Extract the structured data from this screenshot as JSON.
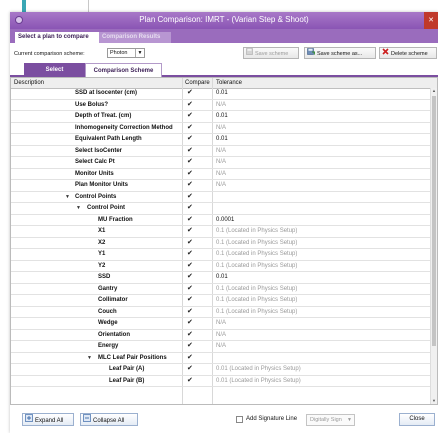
{
  "window": {
    "title": "Plan Comparison: IMRT - (Varian Step & Shoot)",
    "close_glyph": "✕"
  },
  "tabs": [
    {
      "label": "Select a plan to compare",
      "active": true
    },
    {
      "label": "Comparison Results",
      "active": false
    }
  ],
  "scheme": {
    "label": "Current comparison scheme:",
    "value": "Photon",
    "buttons": {
      "save": "Save scheme",
      "save_as": "Save scheme as...",
      "delete": "Delete scheme"
    }
  },
  "subtabs": [
    {
      "label": "Select",
      "active": false
    },
    {
      "label": "Comparison Scheme",
      "active": true
    }
  ],
  "grid": {
    "columns": {
      "description": "Description",
      "compare": "Compare",
      "tolerance": "Tolerance"
    },
    "rows": [
      {
        "level": 0,
        "label": "SSD at Isocenter (cm)",
        "checked": true,
        "tolerance": "0.01",
        "dim": false
      },
      {
        "level": 0,
        "label": "Use Bolus?",
        "checked": true,
        "tolerance": "N/A",
        "dim": true
      },
      {
        "level": 0,
        "label": "Depth of Treat. (cm)",
        "checked": true,
        "tolerance": "0.01",
        "dim": false
      },
      {
        "level": 0,
        "label": "Inhomogeneity Correction Method",
        "checked": true,
        "tolerance": "N/A",
        "dim": true
      },
      {
        "level": 0,
        "label": "Equivalent Path Length",
        "checked": true,
        "tolerance": "0.01",
        "dim": false
      },
      {
        "level": 0,
        "label": "Select IsoCenter",
        "checked": true,
        "tolerance": "N/A",
        "dim": true
      },
      {
        "level": 0,
        "label": "Select Calc Pt",
        "checked": true,
        "tolerance": "N/A",
        "dim": true
      },
      {
        "level": 0,
        "label": "Monitor Units",
        "checked": true,
        "tolerance": "N/A",
        "dim": true
      },
      {
        "level": 0,
        "label": "Plan Monitor Units",
        "checked": true,
        "tolerance": "N/A",
        "dim": true
      },
      {
        "level": -1,
        "label": "Control Points",
        "checked": true,
        "tolerance": "",
        "dim": false,
        "group": true
      },
      {
        "level": -2,
        "label": "Control Point",
        "checked": true,
        "tolerance": "",
        "dim": false,
        "group": true
      },
      {
        "level": 1,
        "label": "MU Fraction",
        "checked": true,
        "tolerance": "0.0001",
        "dim": false
      },
      {
        "level": 1,
        "label": "X1",
        "checked": true,
        "tolerance": "0.1 (Located in Physics Setup)",
        "dim": true
      },
      {
        "level": 1,
        "label": "X2",
        "checked": true,
        "tolerance": "0.1 (Located in Physics Setup)",
        "dim": true
      },
      {
        "level": 1,
        "label": "Y1",
        "checked": true,
        "tolerance": "0.1 (Located in Physics Setup)",
        "dim": true
      },
      {
        "level": 1,
        "label": "Y2",
        "checked": true,
        "tolerance": "0.1 (Located in Physics Setup)",
        "dim": true
      },
      {
        "level": 1,
        "label": "SSD",
        "checked": true,
        "tolerance": "0.01",
        "dim": false
      },
      {
        "level": 1,
        "label": "Gantry",
        "checked": true,
        "tolerance": "0.1 (Located in Physics Setup)",
        "dim": true
      },
      {
        "level": 1,
        "label": "Collimator",
        "checked": true,
        "tolerance": "0.1 (Located in Physics Setup)",
        "dim": true
      },
      {
        "level": 1,
        "label": "Couch",
        "checked": true,
        "tolerance": "0.1 (Located in Physics Setup)",
        "dim": true
      },
      {
        "level": 1,
        "label": "Wedge",
        "checked": true,
        "tolerance": "N/A",
        "dim": true
      },
      {
        "level": 1,
        "label": "Orientation",
        "checked": true,
        "tolerance": "N/A",
        "dim": true
      },
      {
        "level": 1,
        "label": "Energy",
        "checked": true,
        "tolerance": "N/A",
        "dim": true
      },
      {
        "level": -3,
        "label": "MLC Leaf Pair Positions",
        "checked": true,
        "tolerance": "",
        "dim": false,
        "group": true
      },
      {
        "level": 2,
        "label": "Leaf Pair (A)",
        "checked": true,
        "tolerance": "0.01 (Located in Physics Setup)",
        "dim": true
      },
      {
        "level": 2,
        "label": "Leaf Pair (B)",
        "checked": true,
        "tolerance": "0.01 (Located in Physics Setup)",
        "dim": true
      }
    ]
  },
  "footer": {
    "expand_all": "Expand All",
    "collapse_all": "Collapse All",
    "signature_label": "Add Signature Line",
    "digitally_sign": "Digitally Sign",
    "close": "Close"
  },
  "colors": {
    "titlebar": "#9a6cbd",
    "accent": "#7b4ea0",
    "delete_x": "#cc1f1f"
  }
}
